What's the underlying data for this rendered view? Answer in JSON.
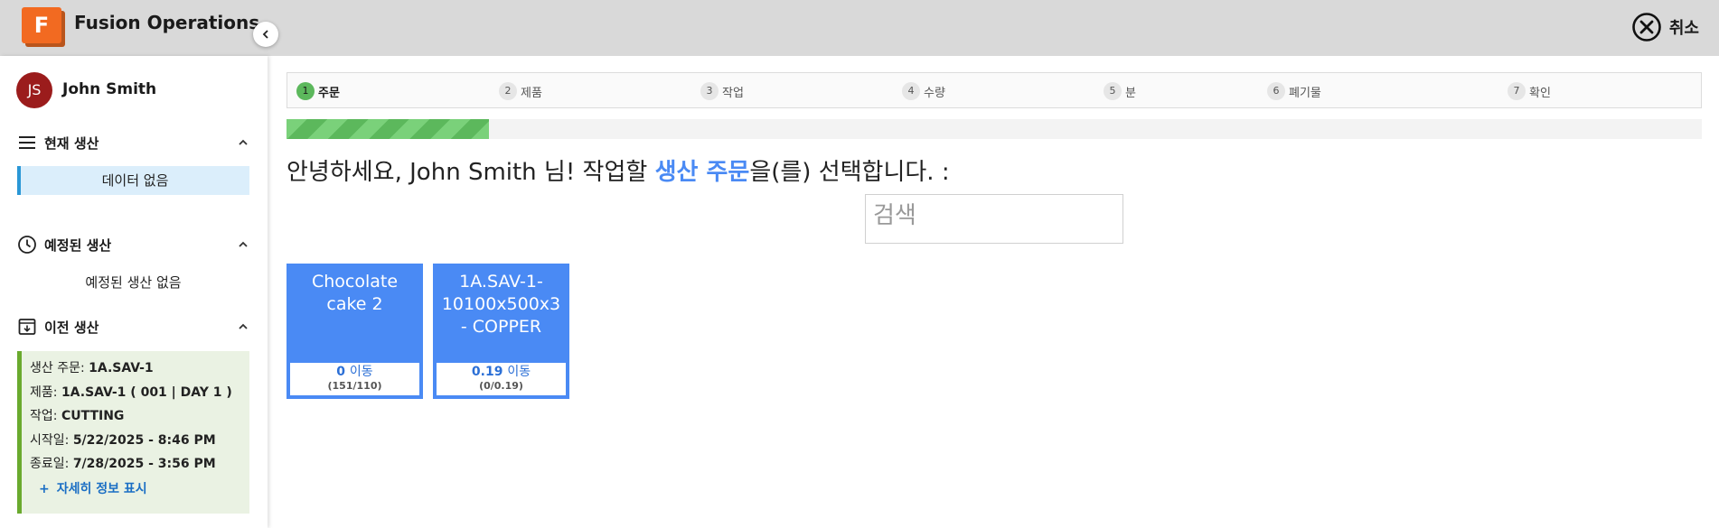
{
  "app": {
    "logo_letter": "F",
    "title": "Fusion Operations",
    "cancel_label": "취소"
  },
  "user": {
    "initials": "JS",
    "name": "John Smith"
  },
  "sidebar": {
    "current": {
      "title": "현재 생산",
      "empty_text": "데이터 없음"
    },
    "scheduled": {
      "title": "예정된 생산",
      "empty_text": "예정된 생산 없음"
    },
    "previous": {
      "title": "이전 생산",
      "order_label": "생산 주문:",
      "order_value": "1A.SAV-1",
      "product_label": "제품:",
      "product_value": "1A.SAV-1 ( 001 | DAY 1 )",
      "operation_label": "작업:",
      "operation_value": "CUTTING",
      "start_label": "시작일:",
      "start_value": "5/22/2025 - 8:46 PM",
      "end_label": "종료일:",
      "end_value": "7/28/2025 - 3:56 PM",
      "more_label": "자세히 정보 표시"
    }
  },
  "steps": [
    {
      "num": "1",
      "label": "주문"
    },
    {
      "num": "2",
      "label": "제품"
    },
    {
      "num": "3",
      "label": "작업"
    },
    {
      "num": "4",
      "label": "수량"
    },
    {
      "num": "5",
      "label": "분"
    },
    {
      "num": "6",
      "label": "폐기물"
    },
    {
      "num": "7",
      "label": "확인"
    }
  ],
  "progress": {
    "fraction": 0.143
  },
  "greeting": {
    "before": "안녕하세요, ",
    "name": "John Smith",
    "middle": " 님! 작업할 ",
    "highlight": "생산 주문",
    "after": "을(를) 선택합니다. :"
  },
  "search": {
    "placeholder": "검색"
  },
  "orders": [
    {
      "name": "Chocolate cake 2",
      "qty": "0",
      "unit": "이동",
      "ratio": "(151/110)"
    },
    {
      "name": "1A.SAV-1-10100x500x3 - COPPER",
      "qty": "0.19",
      "unit": "이동",
      "ratio": "(0/0.19)"
    }
  ],
  "colors": {
    "accent": "#4a8af4",
    "success": "#5cb85c",
    "brand": "#f26a21",
    "avatar": "#9b1c1c"
  }
}
